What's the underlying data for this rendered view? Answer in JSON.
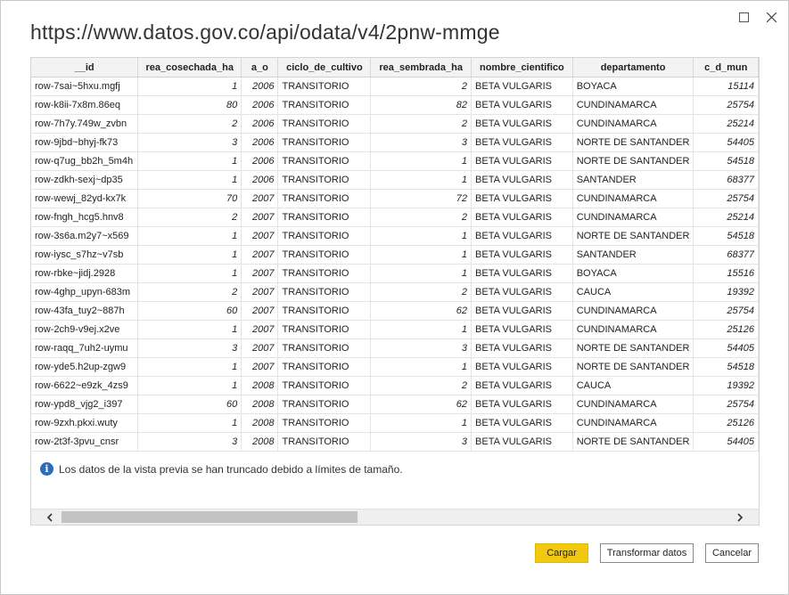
{
  "window": {
    "title": "https://www.datos.gov.co/api/odata/v4/2pnw-mmge",
    "maximize_icon": "maximize-icon",
    "close_icon": "close-icon"
  },
  "table": {
    "columns": [
      "__id",
      "rea_cosechada_ha",
      "a_o",
      "ciclo_de_cultivo",
      "rea_sembrada_ha",
      "nombre_cientifico",
      "departamento",
      "c_d_mun"
    ],
    "numeric_columns": [
      1,
      2,
      4,
      7
    ],
    "rows": [
      [
        "row-7sai~5hxu.mgfj",
        "1",
        "2006",
        "TRANSITORIO",
        "2",
        "BETA VULGARIS",
        "BOYACA",
        "15114"
      ],
      [
        "row-k8ii-7x8m.86eq",
        "80",
        "2006",
        "TRANSITORIO",
        "82",
        "BETA VULGARIS",
        "CUNDINAMARCA",
        "25754"
      ],
      [
        "row-7h7y.749w_zvbn",
        "2",
        "2006",
        "TRANSITORIO",
        "2",
        "BETA VULGARIS",
        "CUNDINAMARCA",
        "25214"
      ],
      [
        "row-9jbd~bhyj-fk73",
        "3",
        "2006",
        "TRANSITORIO",
        "3",
        "BETA VULGARIS",
        "NORTE DE SANTANDER",
        "54405"
      ],
      [
        "row-q7ug_bb2h_5m4h",
        "1",
        "2006",
        "TRANSITORIO",
        "1",
        "BETA VULGARIS",
        "NORTE DE SANTANDER",
        "54518"
      ],
      [
        "row-zdkh-sexj~dp35",
        "1",
        "2006",
        "TRANSITORIO",
        "1",
        "BETA VULGARIS",
        "SANTANDER",
        "68377"
      ],
      [
        "row-wewj_82yd-kx7k",
        "70",
        "2007",
        "TRANSITORIO",
        "72",
        "BETA VULGARIS",
        "CUNDINAMARCA",
        "25754"
      ],
      [
        "row-fngh_hcg5.hnv8",
        "2",
        "2007",
        "TRANSITORIO",
        "2",
        "BETA VULGARIS",
        "CUNDINAMARCA",
        "25214"
      ],
      [
        "row-3s6a.m2y7~x569",
        "1",
        "2007",
        "TRANSITORIO",
        "1",
        "BETA VULGARIS",
        "NORTE DE SANTANDER",
        "54518"
      ],
      [
        "row-iysc_s7hz~v7sb",
        "1",
        "2007",
        "TRANSITORIO",
        "1",
        "BETA VULGARIS",
        "SANTANDER",
        "68377"
      ],
      [
        "row-rbke~jidj.2928",
        "1",
        "2007",
        "TRANSITORIO",
        "1",
        "BETA VULGARIS",
        "BOYACA",
        "15516"
      ],
      [
        "row-4ghp_upyn-683m",
        "2",
        "2007",
        "TRANSITORIO",
        "2",
        "BETA VULGARIS",
        "CAUCA",
        "19392"
      ],
      [
        "row-43fa_tuy2~887h",
        "60",
        "2007",
        "TRANSITORIO",
        "62",
        "BETA VULGARIS",
        "CUNDINAMARCA",
        "25754"
      ],
      [
        "row-2ch9-v9ej.x2ve",
        "1",
        "2007",
        "TRANSITORIO",
        "1",
        "BETA VULGARIS",
        "CUNDINAMARCA",
        "25126"
      ],
      [
        "row-raqq_7uh2-uymu",
        "3",
        "2007",
        "TRANSITORIO",
        "3",
        "BETA VULGARIS",
        "NORTE DE SANTANDER",
        "54405"
      ],
      [
        "row-yde5.h2up-zgw9",
        "1",
        "2007",
        "TRANSITORIO",
        "1",
        "BETA VULGARIS",
        "NORTE DE SANTANDER",
        "54518"
      ],
      [
        "row-6622~e9zk_4zs9",
        "1",
        "2008",
        "TRANSITORIO",
        "2",
        "BETA VULGARIS",
        "CAUCA",
        "19392"
      ],
      [
        "row-ypd8_vjg2_i397",
        "60",
        "2008",
        "TRANSITORIO",
        "62",
        "BETA VULGARIS",
        "CUNDINAMARCA",
        "25754"
      ],
      [
        "row-9zxh.pkxi.wuty",
        "1",
        "2008",
        "TRANSITORIO",
        "1",
        "BETA VULGARIS",
        "CUNDINAMARCA",
        "25126"
      ],
      [
        "row-2t3f-3pvu_cnsr",
        "3",
        "2008",
        "TRANSITORIO",
        "3",
        "BETA VULGARIS",
        "NORTE DE SANTANDER",
        "54405"
      ]
    ]
  },
  "notice": {
    "icon": "info-icon",
    "text": "Los datos de la vista previa se han truncado debido a límites de tamaño."
  },
  "scrollbar": {
    "left_icon": "chevron-left-icon",
    "right_icon": "chevron-right-icon"
  },
  "buttons": {
    "load_label": "Cargar",
    "transform_label": "Transformar datos",
    "cancel_label": "Cancelar"
  },
  "colors": {
    "primary_button": "#f2c811",
    "info_icon": "#2a6ebb"
  }
}
